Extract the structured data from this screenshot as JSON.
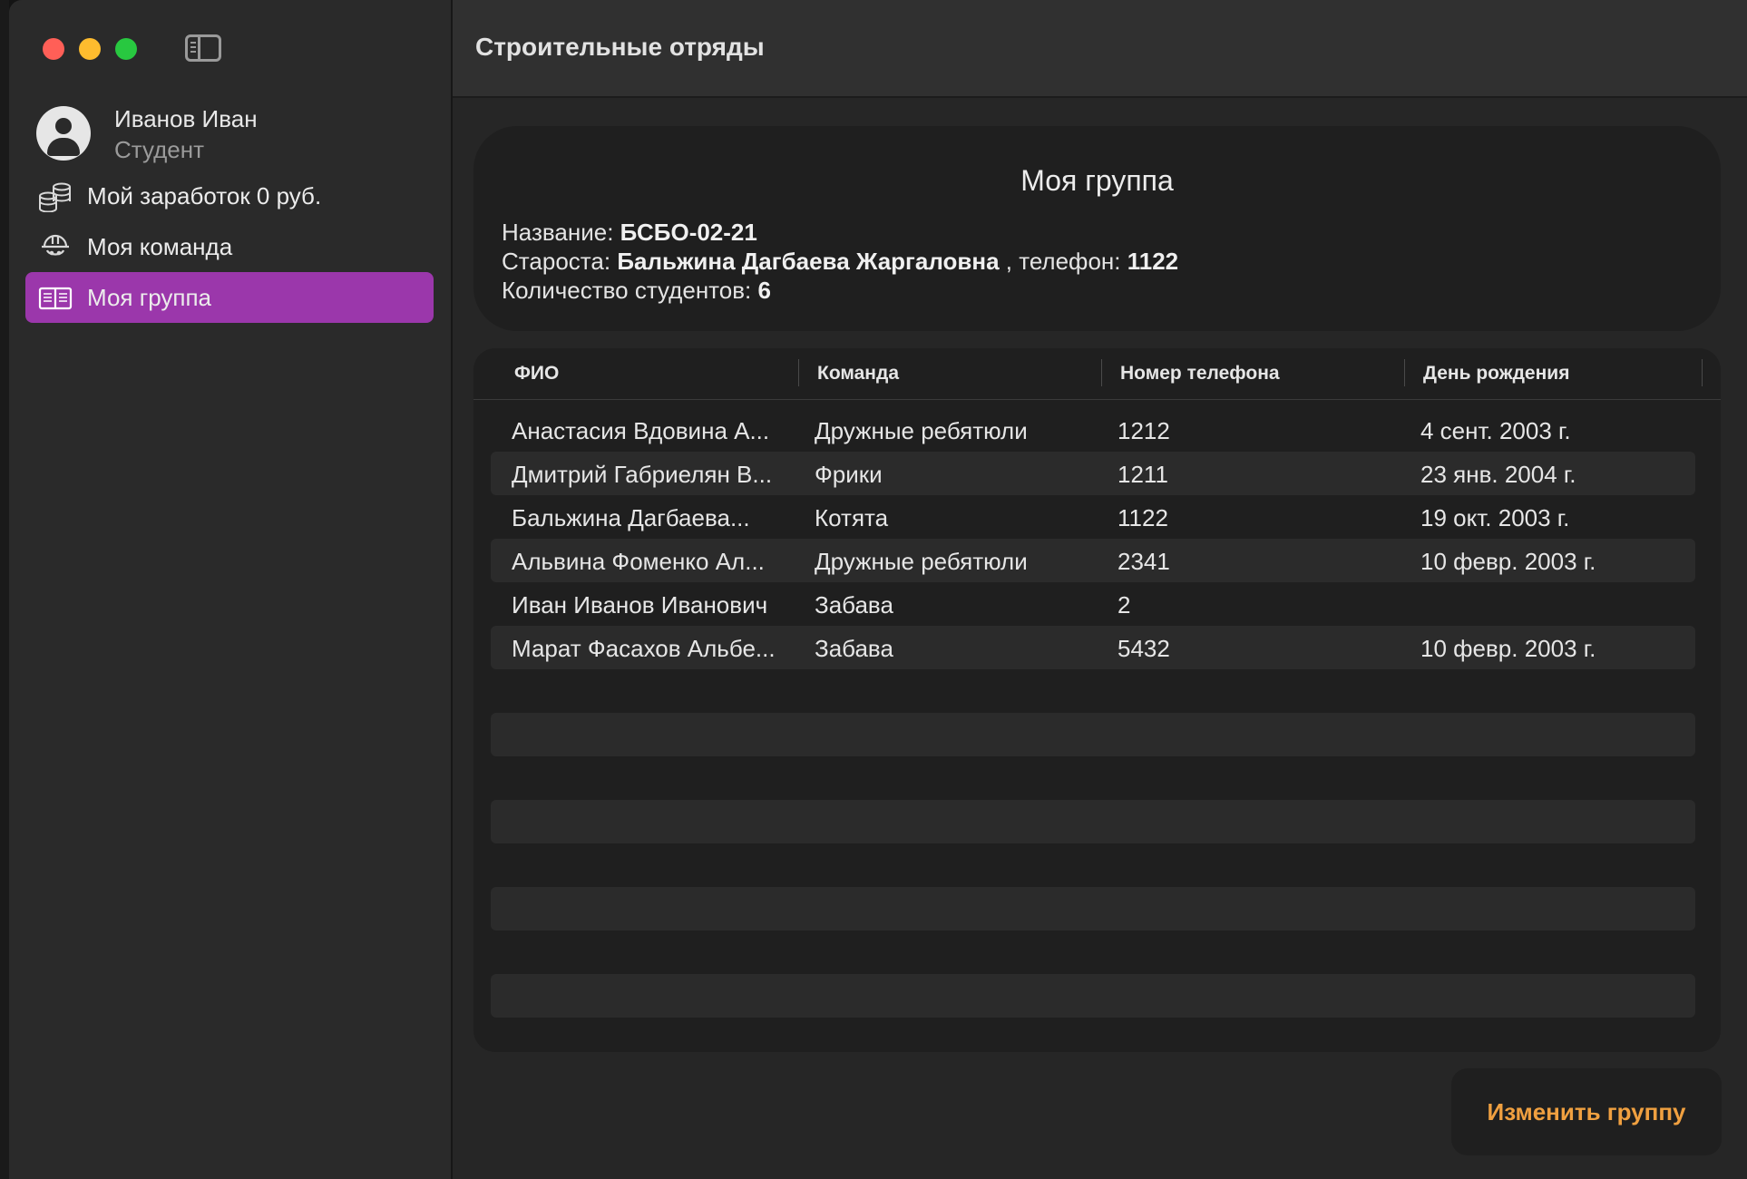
{
  "window": {
    "title": "Строительные отряды"
  },
  "sidebar": {
    "profile": {
      "name": "Иванов Иван",
      "role": "Студент"
    },
    "items": [
      {
        "label": "Мой заработок 0 руб.",
        "icon": "coins-stack-icon"
      },
      {
        "label": "Моя команда",
        "icon": "team-helmet-icon"
      },
      {
        "label": "Моя группа",
        "icon": "open-book-icon",
        "active": true
      }
    ],
    "accent_color": "#9b37ab"
  },
  "group_card": {
    "title": "Моя группа",
    "name_label": "Название:",
    "name_value": "БСБО-02-21",
    "head_label": "Староста:",
    "head_value": "Бальжина Дагбаева Жаргаловна",
    "phone_label": ", телефон:",
    "phone_value": "1122",
    "count_label": "Количество студентов:",
    "count_value": "6"
  },
  "table": {
    "columns": [
      "ФИО",
      "Команда",
      "Номер телефона",
      "День рождения"
    ],
    "rows": [
      [
        "Анастасия Вдовина А...",
        "Дружные ребятюли",
        "1212",
        "4 сент. 2003 г."
      ],
      [
        "Дмитрий Габриелян В...",
        "Фрики",
        "1211",
        "23 янв. 2004 г."
      ],
      [
        "Бальжина Дагбаева...",
        "Котята",
        "1122",
        "19 окт. 2003 г."
      ],
      [
        "Альвина Фоменко Ал...",
        "Дружные ребятюли",
        "2341",
        "10 февр. 2003 г."
      ],
      [
        "Иван Иванов Иванович",
        "Забава",
        "2",
        ""
      ],
      [
        "Марат Фасахов Альбе...",
        "Забава",
        "5432",
        "10 февр. 2003 г."
      ]
    ]
  },
  "actions": {
    "edit_group": "Изменить группу",
    "edit_group_color": "#f0a040"
  }
}
